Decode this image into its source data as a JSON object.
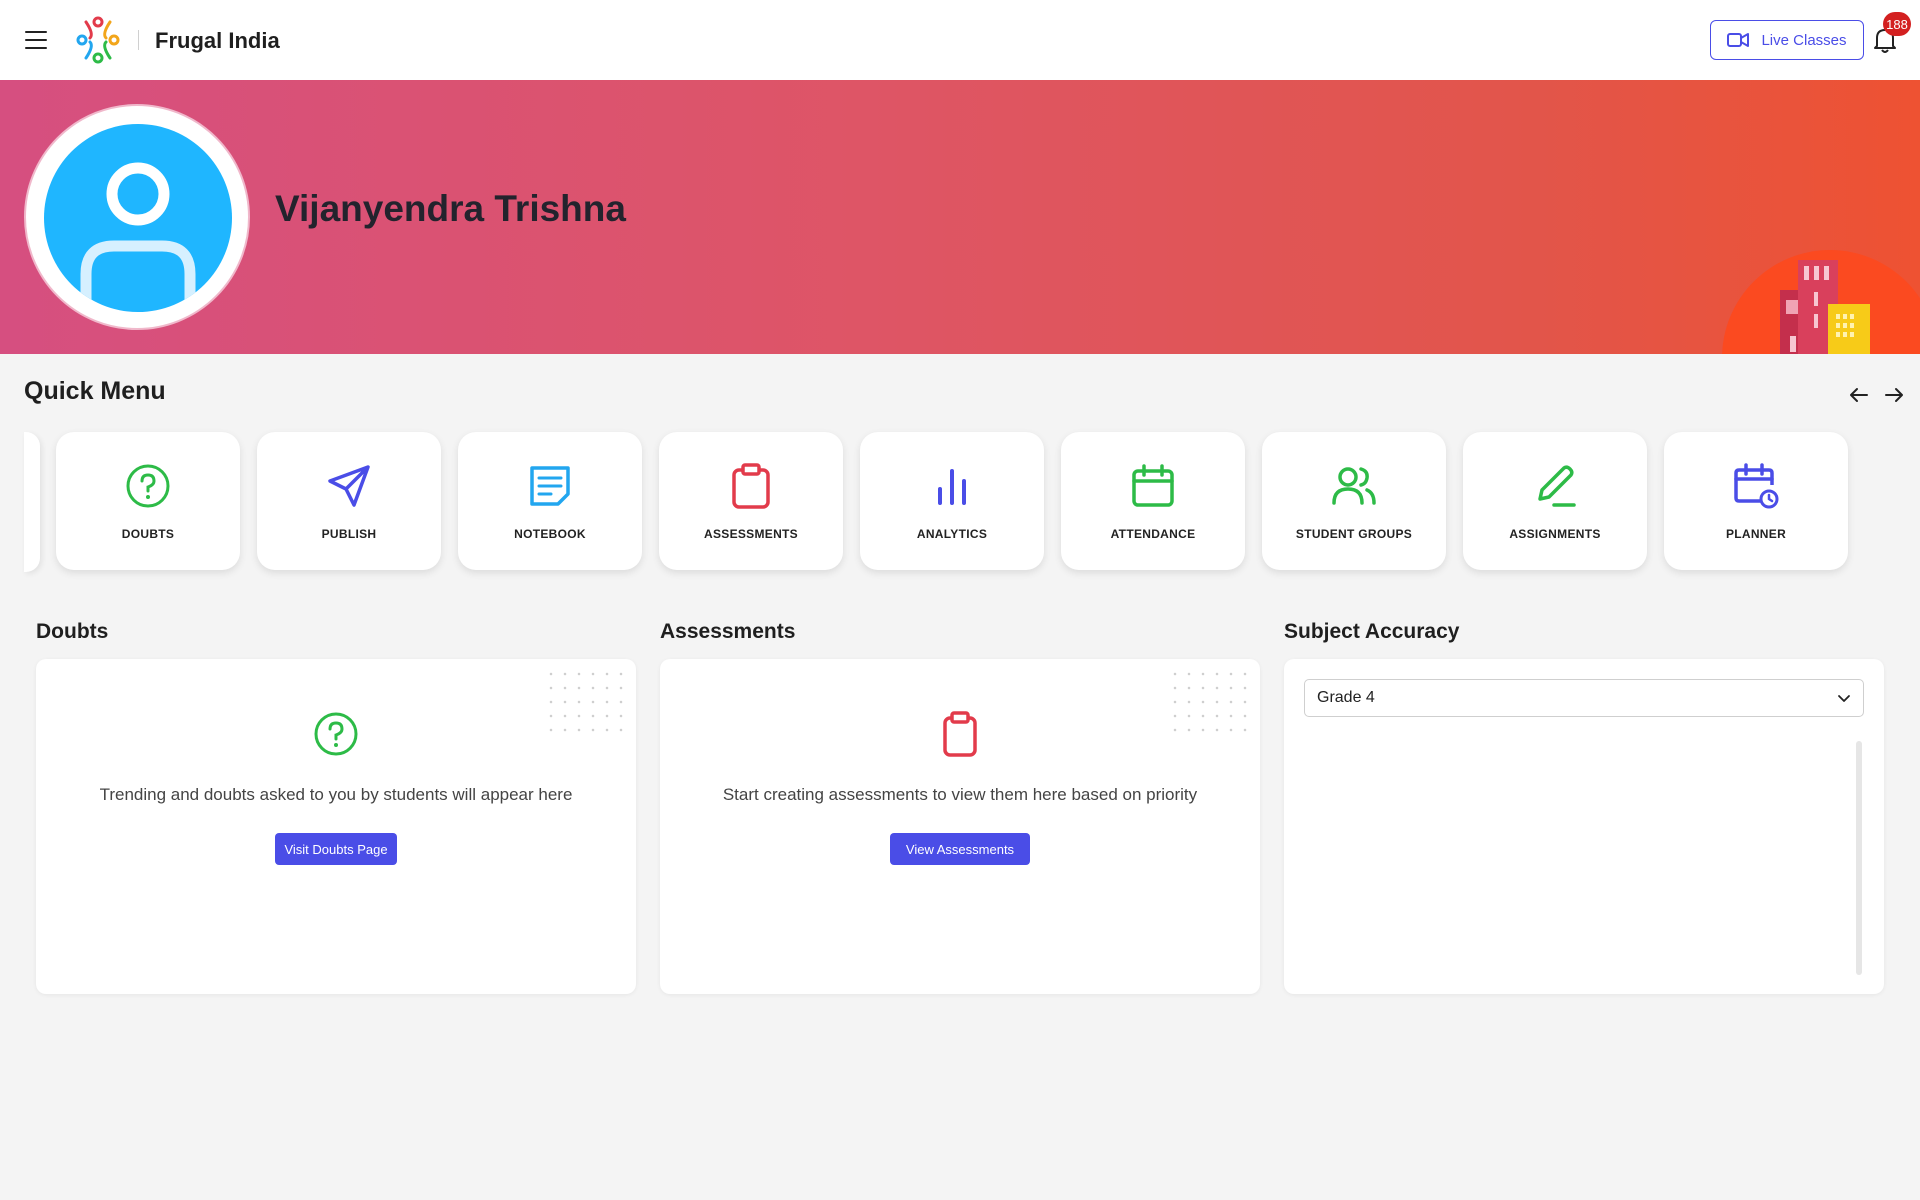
{
  "header": {
    "brand": "Frugal India",
    "live_classes_label": "Live Classes",
    "notification_count": "188"
  },
  "profile": {
    "name": "Vijanyendra Trishna"
  },
  "quick_menu": {
    "title": "Quick Menu",
    "items": [
      {
        "label": "DOUBTS",
        "icon": "question-circle-icon",
        "color": "#2dbb47"
      },
      {
        "label": "PUBLISH",
        "icon": "send-icon",
        "color": "#4a4de7"
      },
      {
        "label": "NOTEBOOK",
        "icon": "notebook-icon",
        "color": "#22a6ef"
      },
      {
        "label": "ASSESSMENTS",
        "icon": "clipboard-icon",
        "color": "#e23b4b"
      },
      {
        "label": "ANALYTICS",
        "icon": "bar-chart-icon",
        "color": "#4a4de7"
      },
      {
        "label": "ATTENDANCE",
        "icon": "calendar-icon",
        "color": "#2dbb47"
      },
      {
        "label": "STUDENT GROUPS",
        "icon": "users-icon",
        "color": "#2dbb47"
      },
      {
        "label": "ASSIGNMENTS",
        "icon": "pen-icon",
        "color": "#2dbb47"
      },
      {
        "label": "PLANNER",
        "icon": "calendar-clock-icon",
        "color": "#4a4de7"
      }
    ]
  },
  "doubts": {
    "title": "Doubts",
    "message": "Trending and doubts asked to you by students will appear here",
    "button": "Visit Doubts Page"
  },
  "assessments": {
    "title": "Assessments",
    "message": "Start creating assessments to view them here based on priority",
    "button": "View Assessments"
  },
  "subject_accuracy": {
    "title": "Subject Accuracy",
    "selected_grade": "Grade 4"
  },
  "colors": {
    "accent": "#4a4de7",
    "banner_start": "#d64f80",
    "banner_end": "#ee5232",
    "avatar": "#1fb6ff",
    "badge": "#d32020"
  }
}
